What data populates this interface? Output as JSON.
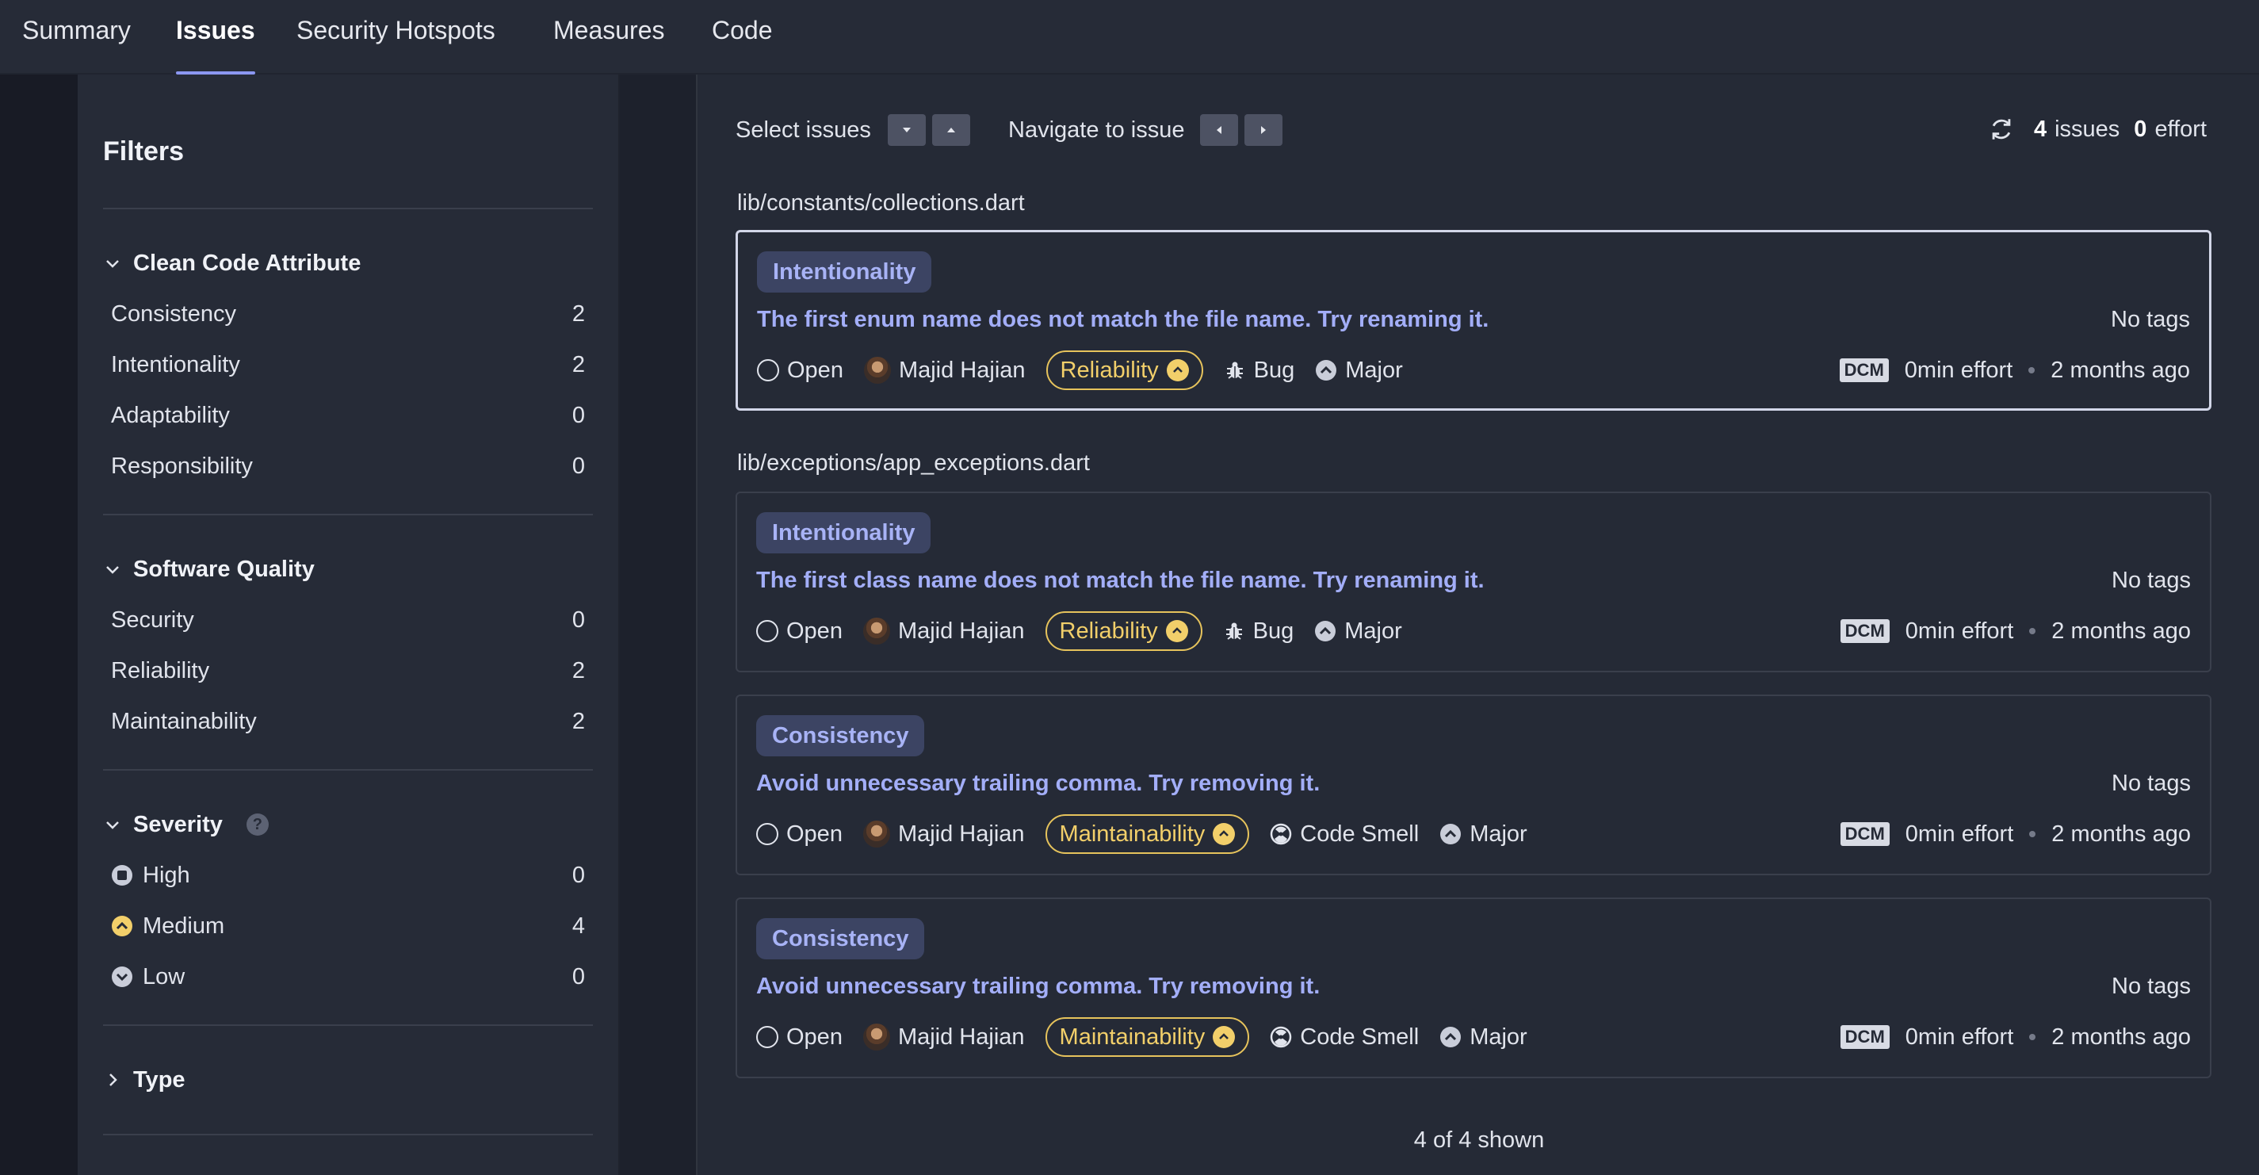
{
  "nav": {
    "tabs": [
      {
        "label": "Summary",
        "active": false
      },
      {
        "label": "Issues",
        "active": true
      },
      {
        "label": "Security Hotspots",
        "active": false
      },
      {
        "label": "Measures",
        "active": false
      },
      {
        "label": "Code",
        "active": false
      }
    ]
  },
  "filters": {
    "title": "Filters",
    "clean_code": {
      "heading": "Clean Code Attribute",
      "items": [
        {
          "label": "Consistency",
          "count": "2"
        },
        {
          "label": "Intentionality",
          "count": "2"
        },
        {
          "label": "Adaptability",
          "count": "0"
        },
        {
          "label": "Responsibility",
          "count": "0"
        }
      ]
    },
    "software_quality": {
      "heading": "Software Quality",
      "items": [
        {
          "label": "Security",
          "count": "0"
        },
        {
          "label": "Reliability",
          "count": "2"
        },
        {
          "label": "Maintainability",
          "count": "2"
        }
      ]
    },
    "severity": {
      "heading": "Severity",
      "help": "?",
      "items": [
        {
          "label": "High",
          "count": "0",
          "icon": "severity-high-icon"
        },
        {
          "label": "Medium",
          "count": "4",
          "icon": "severity-medium-icon"
        },
        {
          "label": "Low",
          "count": "0",
          "icon": "severity-low-icon"
        }
      ]
    },
    "type": {
      "heading": "Type"
    }
  },
  "toolbar": {
    "select_issues": "Select issues",
    "navigate_to_issue": "Navigate to issue",
    "issues_count": "4",
    "issues_word": "issues",
    "effort_count": "0",
    "effort_word": "effort"
  },
  "files": [
    "lib/constants/collections.dart",
    "lib/exceptions/app_exceptions.dart"
  ],
  "issues": [
    {
      "attribute": "Intentionality",
      "title": "The first enum name does not match the file name. Try renaming it.",
      "tags": "No tags",
      "status": "Open",
      "assignee": "Majid Hajian",
      "quality": "Reliability",
      "type": "Bug",
      "severity": "Major",
      "rule_engine": "DCM",
      "effort": "0min effort",
      "age": "2 months ago"
    },
    {
      "attribute": "Intentionality",
      "title": "The first class name does not match the file name. Try renaming it.",
      "tags": "No tags",
      "status": "Open",
      "assignee": "Majid Hajian",
      "quality": "Reliability",
      "type": "Bug",
      "severity": "Major",
      "rule_engine": "DCM",
      "effort": "0min effort",
      "age": "2 months ago"
    },
    {
      "attribute": "Consistency",
      "title": "Avoid unnecessary trailing comma. Try removing it.",
      "tags": "No tags",
      "status": "Open",
      "assignee": "Majid Hajian",
      "quality": "Maintainability",
      "type": "Code Smell",
      "severity": "Major",
      "rule_engine": "DCM",
      "effort": "0min effort",
      "age": "2 months ago"
    },
    {
      "attribute": "Consistency",
      "title": "Avoid unnecessary trailing comma. Try removing it.",
      "tags": "No tags",
      "status": "Open",
      "assignee": "Majid Hajian",
      "quality": "Maintainability",
      "type": "Code Smell",
      "severity": "Major",
      "rule_engine": "DCM",
      "effort": "0min effort",
      "age": "2 months ago"
    }
  ],
  "footer": {
    "shown": "4 of 4 shown"
  },
  "colors": {
    "accent": "#8b97f1",
    "link": "#a3aef8",
    "medium": "#f2cf6a",
    "badge_bg": "#3c4463"
  }
}
